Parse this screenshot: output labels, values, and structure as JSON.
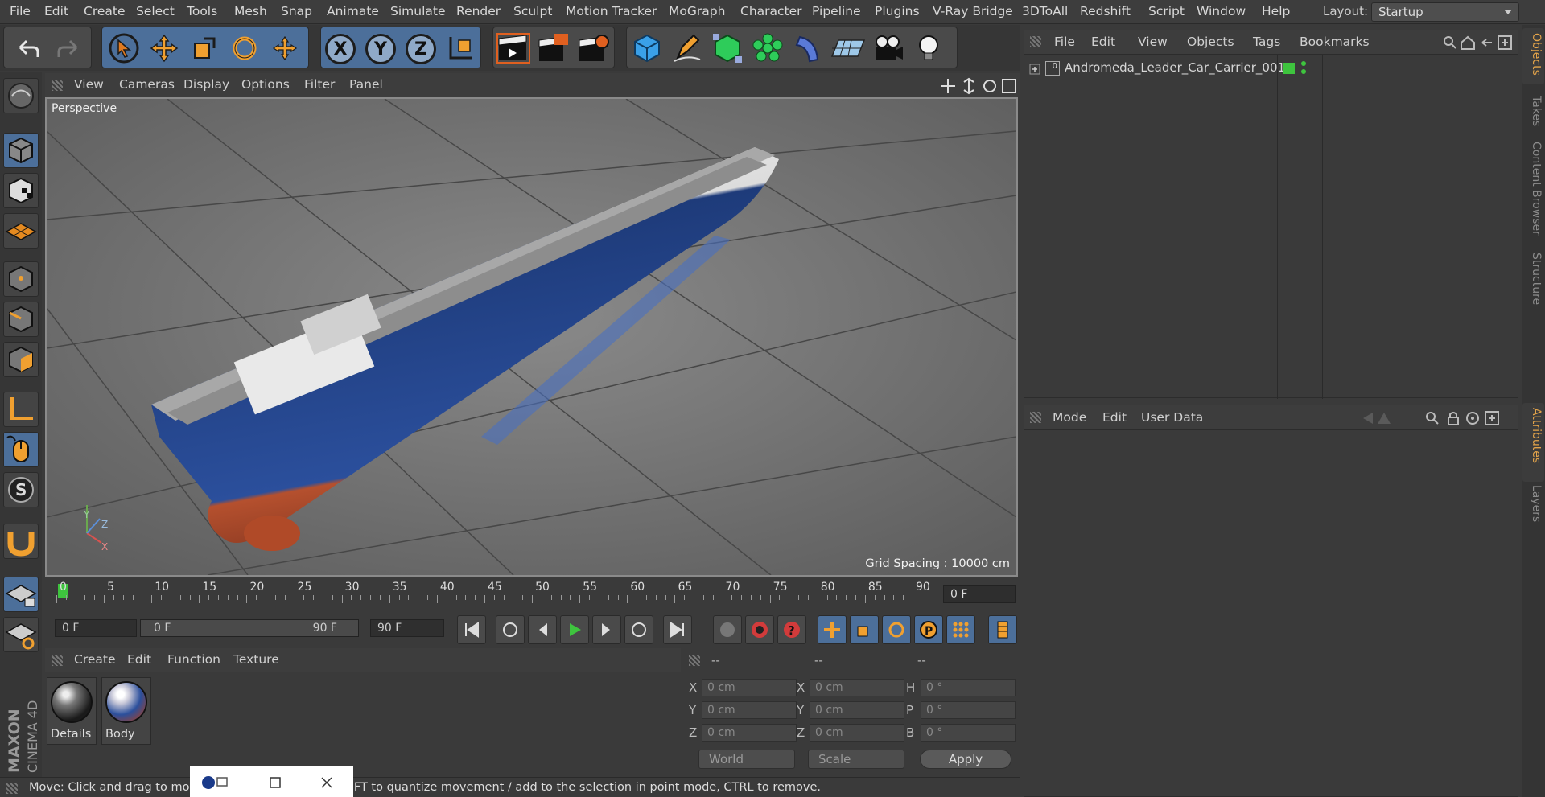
{
  "menubar": {
    "items": [
      "File",
      "Edit",
      "Create",
      "Select",
      "Tools",
      "Mesh",
      "Snap",
      "Animate",
      "Simulate",
      "Render",
      "Sculpt",
      "Motion Tracker",
      "MoGraph",
      "Character",
      "Pipeline",
      "Plugins",
      "V-Ray Bridge",
      "3DToAll",
      "Redshift",
      "Script",
      "Window",
      "Help"
    ],
    "layout_label": "Layout:",
    "layout_value": "Startup"
  },
  "toolbar": {
    "axis_x": "X",
    "axis_y": "Y",
    "axis_z": "Z"
  },
  "viewport": {
    "menu": [
      "View",
      "Cameras",
      "Display",
      "Options",
      "Filter",
      "Panel"
    ],
    "label": "Perspective",
    "grid_spacing": "Grid Spacing : 10000 cm",
    "axis_x": "X",
    "axis_y": "Y",
    "axis_z": "Z"
  },
  "timeline": {
    "ticks": [
      "0",
      "5",
      "10",
      "15",
      "20",
      "25",
      "30",
      "35",
      "40",
      "45",
      "50",
      "55",
      "60",
      "65",
      "70",
      "75",
      "80",
      "85",
      "90"
    ],
    "current_frame": "0 F"
  },
  "transport": {
    "start_field": "0 F",
    "range_start": "0 F",
    "range_end": "90 F",
    "end_field": "90 F"
  },
  "materials": {
    "menu": [
      "Create",
      "Edit",
      "Function",
      "Texture"
    ],
    "items": [
      {
        "label": "Details"
      },
      {
        "label": "Body"
      }
    ]
  },
  "coords": {
    "headers": [
      "--",
      "--",
      "--"
    ],
    "rows": [
      {
        "l1": "X",
        "v1": "0 cm",
        "l2": "X",
        "v2": "0 cm",
        "l3": "H",
        "v3": "0 °"
      },
      {
        "l1": "Y",
        "v1": "0 cm",
        "l2": "Y",
        "v2": "0 cm",
        "l3": "P",
        "v3": "0 °"
      },
      {
        "l1": "Z",
        "v1": "0 cm",
        "l2": "Z",
        "v2": "0 cm",
        "l3": "B",
        "v3": "0 °"
      }
    ],
    "mode_world": "World",
    "mode_scale": "Scale",
    "apply": "Apply"
  },
  "status": {
    "text": "Move: Click and drag to move elements. Hold down SHIFT to quantize movement / add to the selection in point mode, CTRL to remove."
  },
  "objects": {
    "menu": [
      "File",
      "Edit",
      "View",
      "Objects",
      "Tags",
      "Bookmarks"
    ],
    "row_name": "Andromeda_Leader_Car_Carrier_001",
    "row_icon_label": "L0"
  },
  "attributes": {
    "menu": [
      "Mode",
      "Edit",
      "User Data"
    ]
  },
  "right_tabs": [
    "Objects",
    "Takes",
    "Content Browser",
    "Structure",
    "Attributes",
    "Layers"
  ],
  "colors": {
    "accent_orange": "#e2a34a",
    "selection_blue": "#4c6f9a",
    "ok_green": "#3ec43e"
  },
  "logo": {
    "maxon": "MAXON",
    "product": "CINEMA 4D"
  }
}
